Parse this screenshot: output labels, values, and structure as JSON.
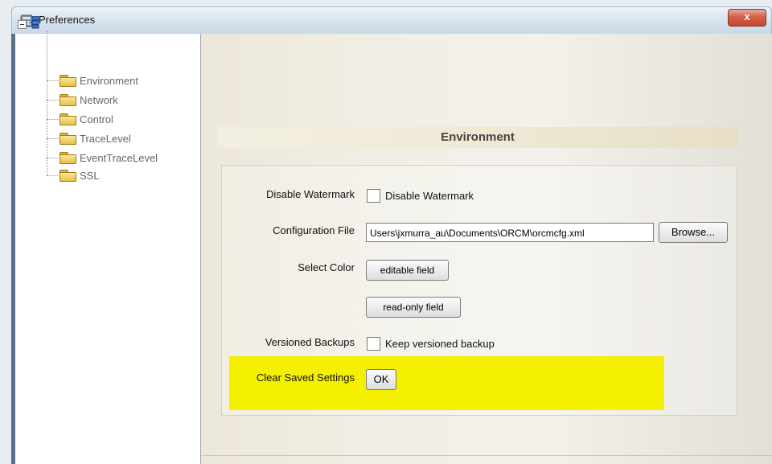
{
  "window": {
    "title": "Preferences",
    "close_label": "x"
  },
  "tree": {
    "root_icon": "network-node-icon",
    "items": [
      {
        "label": "Environment",
        "icon": "folder-icon"
      },
      {
        "label": "Network",
        "icon": "folder-icon"
      },
      {
        "label": "Control",
        "icon": "folder-icon"
      },
      {
        "label": "TraceLevel",
        "icon": "folder-icon"
      },
      {
        "label": "EventTraceLevel",
        "icon": "folder-icon"
      },
      {
        "label": "SSL",
        "icon": "folder-icon"
      }
    ]
  },
  "panel": {
    "header": "Environment",
    "disable_watermark": {
      "label": "Disable Watermark",
      "checkbox_label": "Disable Watermark",
      "checked": false
    },
    "configuration_file": {
      "label": "Configuration File",
      "value": "Users\\jxmurra_au\\Documents\\ORCM\\orcmcfg.xml",
      "browse_label": "Browse..."
    },
    "select_color": {
      "label": "Select Color",
      "editable_label": "editable field",
      "readonly_label": "read-only field"
    },
    "versioned_backups": {
      "label": "Versioned Backups",
      "checkbox_label": "Keep versioned backup",
      "checked": false
    },
    "clear_saved_settings": {
      "label": "Clear Saved Settings",
      "ok_label": "OK"
    },
    "highlight_color": "#f4f000"
  }
}
